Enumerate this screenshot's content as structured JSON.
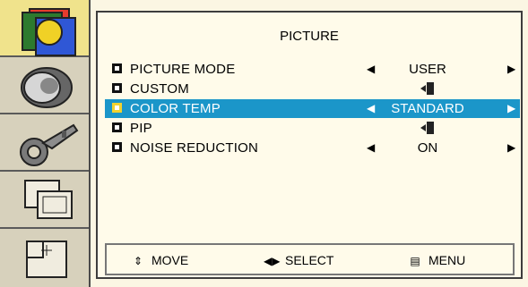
{
  "window": {
    "title": "PICTURE"
  },
  "sidebar": {
    "items": [
      {
        "name": "picture",
        "selected": true
      },
      {
        "name": "sound",
        "selected": false
      },
      {
        "name": "setup",
        "selected": false
      },
      {
        "name": "screen",
        "selected": false
      },
      {
        "name": "pip",
        "selected": false
      }
    ]
  },
  "menu": {
    "items": [
      {
        "label": "PICTURE MODE",
        "value": "USER",
        "type": "select",
        "selected": false
      },
      {
        "label": "CUSTOM",
        "value": "",
        "type": "submenu",
        "selected": false
      },
      {
        "label": "COLOR TEMP",
        "value": "STANDARD",
        "type": "select",
        "selected": true
      },
      {
        "label": "PIP",
        "value": "",
        "type": "submenu",
        "selected": false
      },
      {
        "label": "NOISE REDUCTION",
        "value": "ON",
        "type": "select",
        "selected": false
      }
    ]
  },
  "footer": {
    "move": "MOVE",
    "select": "SELECT",
    "menu": "MENU"
  },
  "colors": {
    "highlight": "#1b96c9",
    "panel_bg": "#fbf6e3",
    "sidebar_selected": "#f0e38c"
  }
}
